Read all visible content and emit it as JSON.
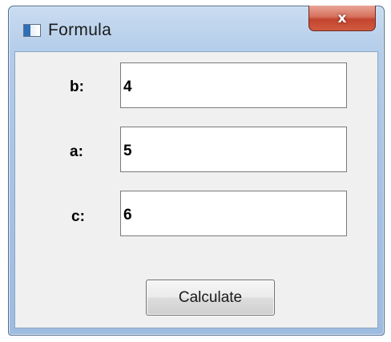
{
  "window": {
    "title": "Formula",
    "close_glyph": "x"
  },
  "fields": [
    {
      "label": "b:",
      "value": "4"
    },
    {
      "label": "a:",
      "value": "5"
    },
    {
      "label": "c:",
      "value": "6"
    }
  ],
  "buttons": {
    "calculate_label": "Calculate"
  },
  "icons": {
    "app": "window-app-icon",
    "close": "close-icon"
  },
  "colors": {
    "close_button": "#c3452f",
    "frame": "#a8c4e6",
    "client_background": "#f0f0f0"
  }
}
